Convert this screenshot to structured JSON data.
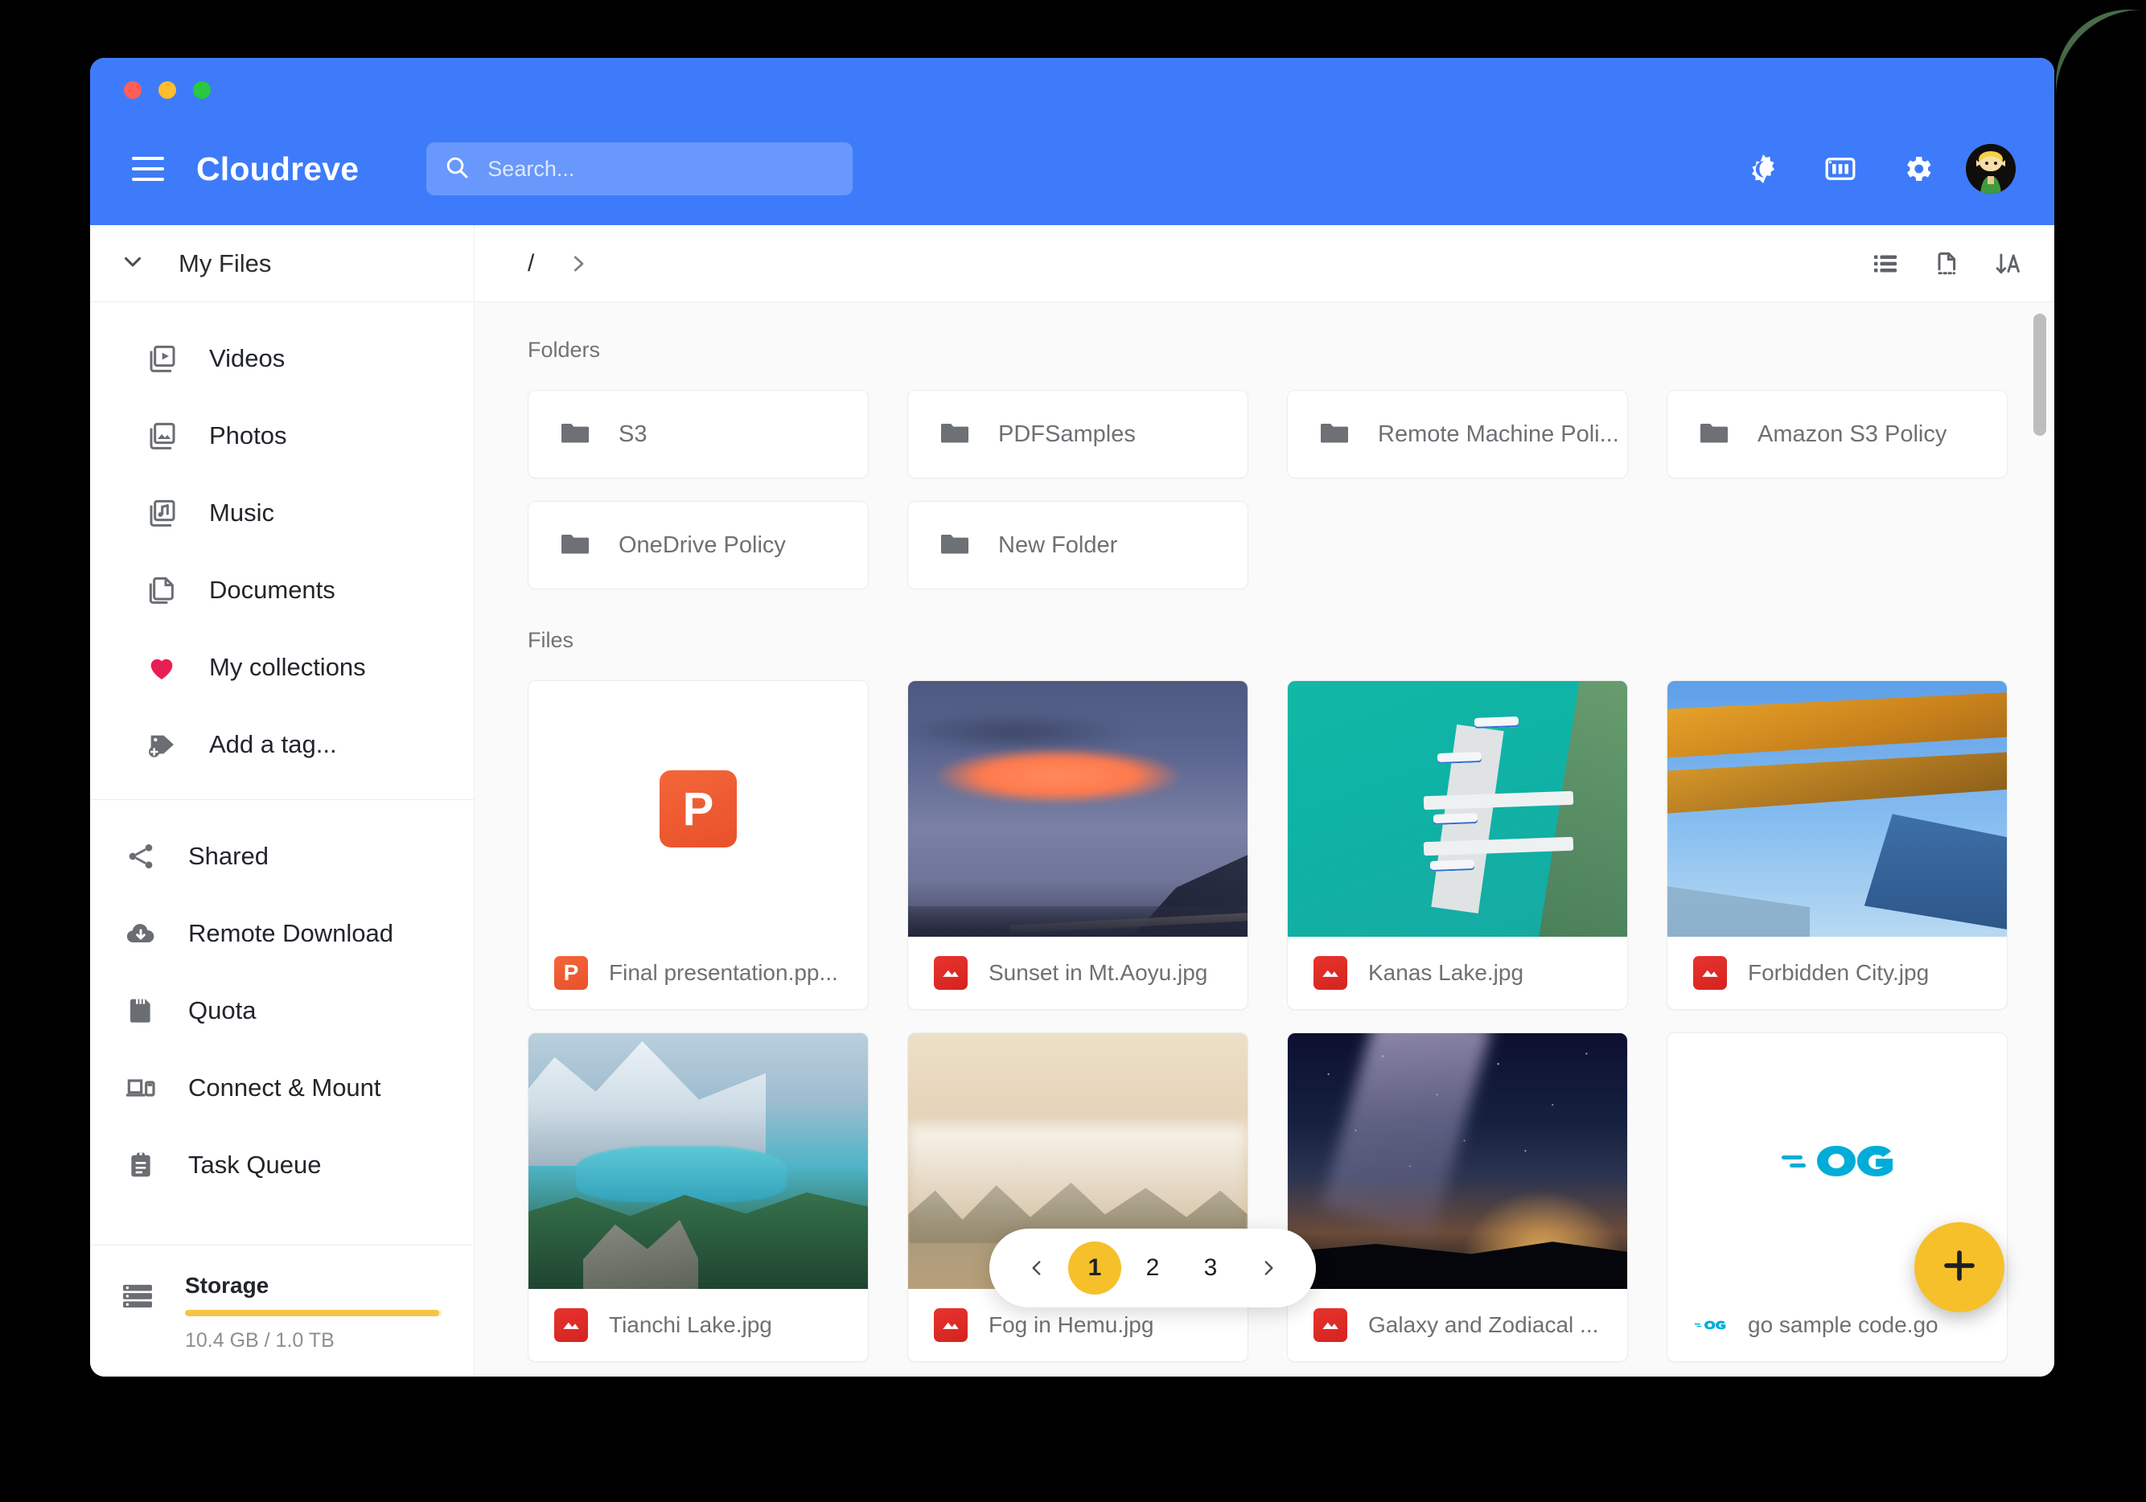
{
  "app": {
    "title": "Cloudreve",
    "accent_blue": "#3e7bfa",
    "accent_yellow": "#f6c02b"
  },
  "window_controls": {
    "close_label": "Close",
    "minimize_label": "Minimize",
    "maximize_label": "Maximize"
  },
  "appbar": {
    "menu_icon": "hamburger-menu-icon",
    "brand": "Cloudreve",
    "search_placeholder": "Search...",
    "search_value": "",
    "search_icon": "search-icon",
    "right_icons": [
      {
        "name": "dark-mode-icon",
        "label": "Dark mode"
      },
      {
        "name": "storage-policy-icon",
        "label": "Storage policy"
      },
      {
        "name": "gear-icon",
        "label": "Settings"
      }
    ],
    "avatar_label": "User avatar"
  },
  "sidebar": {
    "my_files": {
      "label": "My Files",
      "expand_icon": "chevron-down-icon"
    },
    "categories": [
      {
        "label": "Videos",
        "icon": "videos-icon"
      },
      {
        "label": "Photos",
        "icon": "photos-icon"
      },
      {
        "label": "Music",
        "icon": "music-icon"
      },
      {
        "label": "Documents",
        "icon": "documents-icon"
      },
      {
        "label": "My collections",
        "icon": "heart-icon"
      },
      {
        "label": "Add a tag...",
        "icon": "tag-plus-icon"
      }
    ],
    "tools": [
      {
        "label": "Shared",
        "icon": "share-icon"
      },
      {
        "label": "Remote Download",
        "icon": "cloud-download-icon"
      },
      {
        "label": "Quota",
        "icon": "quota-card-icon"
      },
      {
        "label": "Connect & Mount",
        "icon": "connect-mount-icon"
      },
      {
        "label": "Task Queue",
        "icon": "clipboard-icon"
      }
    ],
    "storage": {
      "title": "Storage",
      "icon": "storage-server-icon",
      "usage_text": "10.4 GB / 1.0 TB",
      "used": "10.4 GB",
      "total": "1.0 TB",
      "percent": 99,
      "bar_color": "#f6c445"
    }
  },
  "breadcrumb": {
    "root": "/",
    "separator_icon": "chevron-right-icon"
  },
  "view_tools": [
    {
      "name": "list-view-icon",
      "label": "List view"
    },
    {
      "name": "select-file-icon",
      "label": "Selection mode"
    },
    {
      "name": "sort-az-icon",
      "label": "Sort"
    }
  ],
  "main": {
    "folders_heading": "Folders",
    "files_heading": "Files",
    "folders": [
      {
        "name": "S3"
      },
      {
        "name": "PDFSamples"
      },
      {
        "name": "Remote Machine Poli..."
      },
      {
        "name": "Amazon S3 Policy"
      },
      {
        "name": "OneDrive Policy"
      },
      {
        "name": "New Folder"
      }
    ],
    "files": [
      {
        "name": "Final presentation.pp...",
        "type": "ppt",
        "badge": "P",
        "thumb": "blank-ppt"
      },
      {
        "name": "Sunset in Mt.Aoyu.jpg",
        "type": "image",
        "badge": "img",
        "thumb": "sunset"
      },
      {
        "name": "Kanas Lake.jpg",
        "type": "image",
        "badge": "img",
        "thumb": "kanas"
      },
      {
        "name": "Forbidden City.jpg",
        "type": "image",
        "badge": "img",
        "thumb": "city"
      },
      {
        "name": "Tianchi Lake.jpg",
        "type": "image",
        "badge": "img",
        "thumb": "lake"
      },
      {
        "name": "Fog in Hemu.jpg",
        "type": "image",
        "badge": "img",
        "thumb": "fog"
      },
      {
        "name": "Galaxy and Zodiacal ...",
        "type": "image",
        "badge": "img",
        "thumb": "galaxy"
      },
      {
        "name": "go sample code.go",
        "type": "go",
        "badge": "GO",
        "thumb": "blank-go"
      }
    ]
  },
  "pagination": {
    "prev_icon": "chevron-left-icon",
    "next_icon": "chevron-right-icon",
    "pages": [
      "1",
      "2",
      "3"
    ],
    "current": "1"
  },
  "fab": {
    "label": "Add",
    "icon": "plus-icon"
  }
}
